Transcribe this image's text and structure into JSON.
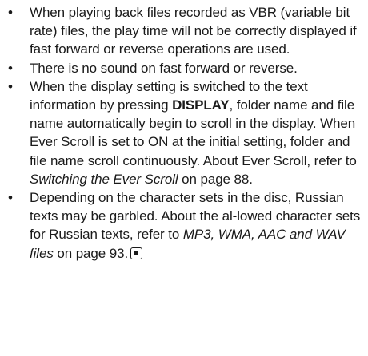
{
  "bullet_char": "•",
  "items": [
    {
      "text": "When playing back files recorded as VBR (variable bit rate) files, the play time will not be correctly displayed if fast forward or reverse operations are used."
    },
    {
      "text": "There is no sound on fast forward or reverse."
    },
    {
      "pre": "When the display setting is switched to the text information by pressing ",
      "bold": "DISPLAY",
      "mid": ", folder name and file name automatically begin to scroll in the display. When Ever Scroll is set to ON at the initial setting, folder and file name scroll continuously. About Ever Scroll, refer to ",
      "ref": "Switching the Ever Scroll",
      "post": " on page 88."
    },
    {
      "pre": "Depending on the character sets in the disc, Russian texts may be garbled. About the al-lowed character sets for Russian texts, refer to ",
      "ref": "MP3, WMA, AAC and WAV files",
      "post": " on page 93."
    }
  ],
  "end_mark_icon": "end-of-section-square-icon"
}
